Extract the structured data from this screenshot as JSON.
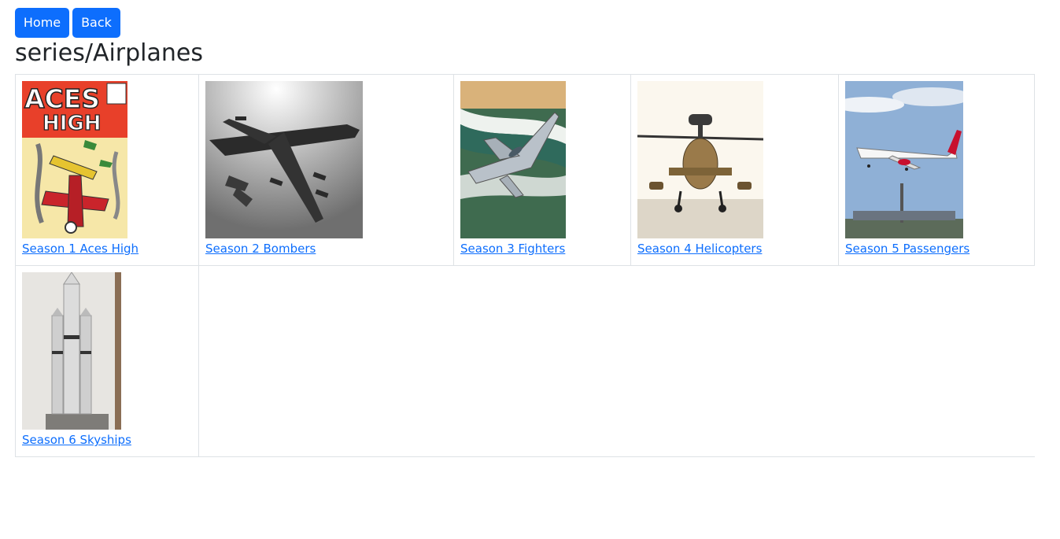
{
  "nav": {
    "home_label": "Home",
    "back_label": "Back"
  },
  "page": {
    "title": "series/Airplanes"
  },
  "seasons": [
    {
      "label": "Season 1 Aces High",
      "image": "aces-high-comic-cover"
    },
    {
      "label": "Season 2 Bombers",
      "image": "bomber-aircraft"
    },
    {
      "label": "Season 3 Fighters",
      "image": "fighter-jet-over-coast"
    },
    {
      "label": "Season 4 Helicopters",
      "image": "attack-helicopter"
    },
    {
      "label": "Season 5 Passengers",
      "image": "passenger-airliner-landing"
    },
    {
      "label": "Season 6 Skyships",
      "image": "rocket-on-launch-pad"
    }
  ],
  "thumbs": {
    "comic_title_line1": "ACES",
    "comic_title_line2": "HIGH"
  },
  "colors": {
    "link": "#0d6efd",
    "button": "#0d6efd",
    "border": "#dee2e6"
  }
}
